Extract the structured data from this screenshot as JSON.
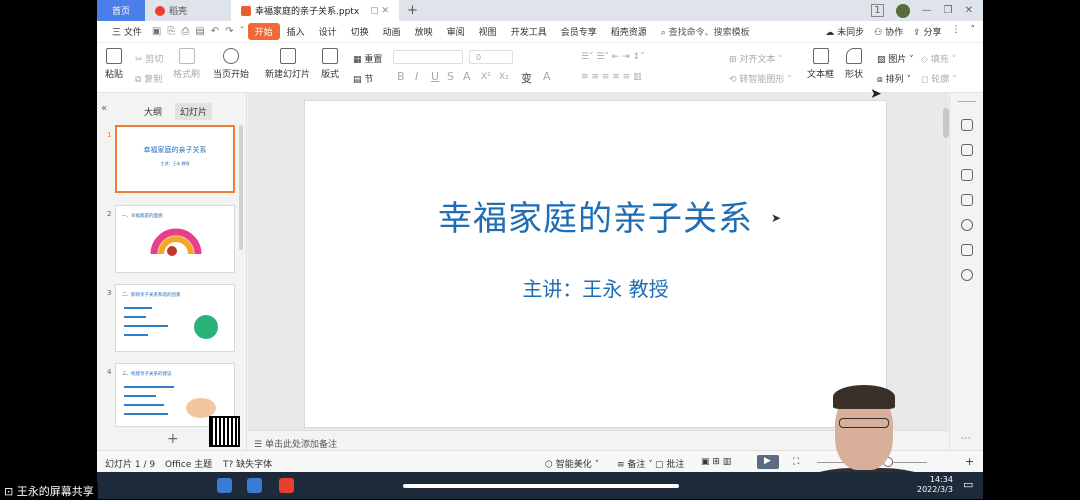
{
  "tabs": {
    "home": "首页",
    "daoke": "稻壳",
    "doc": "幸福家庭的亲子关系.pptx"
  },
  "window": {
    "badge": "1"
  },
  "menu": {
    "file": "三 文件",
    "items": [
      "开始",
      "插入",
      "设计",
      "切换",
      "动画",
      "放映",
      "审阅",
      "视图",
      "开发工具",
      "会员专享",
      "稻壳资源"
    ],
    "search": "查找命令、搜索模板",
    "right": [
      "未同步",
      "协作",
      "分享"
    ]
  },
  "toolbar": {
    "paste": "粘贴",
    "cut": "剪切",
    "copy": "复制",
    "format_painter": "格式刷",
    "from_current": "当页开始",
    "new_slide": "新建幻灯片",
    "layout": "版式",
    "section": "节",
    "reset": "重置",
    "font_size": "0",
    "align_text": "对齐文本",
    "smart_art": "转智能图形",
    "textbox": "文本框",
    "shape": "形状",
    "picture": "图片",
    "fill": "填充",
    "arrange": "排列",
    "outline": "轮廓",
    "format_buttons": [
      "B",
      "I",
      "U",
      "S",
      "A",
      "X²",
      "X₂",
      "变",
      "A"
    ]
  },
  "left_panel": {
    "tab_outline": "大纲",
    "tab_slides": "幻灯片",
    "thumbs": [
      {
        "num": "1",
        "title": "幸福家庭的亲子关系",
        "sub": "主讲：王永 教授"
      },
      {
        "num": "2",
        "head": "一、幸福家庭的面貌"
      },
      {
        "num": "3",
        "head": "二、影响亲子关系和谐的因素"
      },
      {
        "num": "4",
        "head": "三、构建亲子关系的建议"
      }
    ]
  },
  "slide": {
    "title": "幸福家庭的亲子关系",
    "subtitle": "主讲：王永 教授"
  },
  "notes": {
    "placeholder": "单击此处添加备注"
  },
  "status": {
    "slide_count": "幻灯片 1 / 9",
    "theme": "Office 主题",
    "missing_font": "缺失字体",
    "beautify": "智能美化",
    "notes_btn": "备注",
    "comment_btn": "批注",
    "zoom_plus": "+"
  },
  "taskbar": {
    "share_label": "王永的屏幕共享",
    "time": "14:34",
    "date": "2022/3/3"
  },
  "colors": {
    "accent": "#f06a35",
    "title_blue": "#1f6db5",
    "tab_blue": "#4a7ee8"
  }
}
